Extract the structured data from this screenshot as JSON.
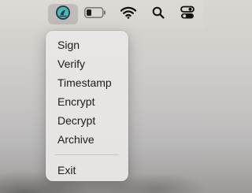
{
  "menubar": {
    "icons": [
      "signing-app-icon",
      "battery-icon",
      "wifi-icon",
      "search-icon",
      "control-center-icon"
    ]
  },
  "menu": {
    "items": [
      {
        "label": "Sign"
      },
      {
        "label": "Verify"
      },
      {
        "label": "Timestamp"
      },
      {
        "label": "Encrypt"
      },
      {
        "label": "Decrypt"
      },
      {
        "label": "Archive"
      }
    ],
    "exit_label": "Exit"
  },
  "colors": {
    "menu_background": "#e8e6e5",
    "app_icon_teal": "#4fb7b3",
    "app_icon_dark": "#1f3a4a"
  }
}
